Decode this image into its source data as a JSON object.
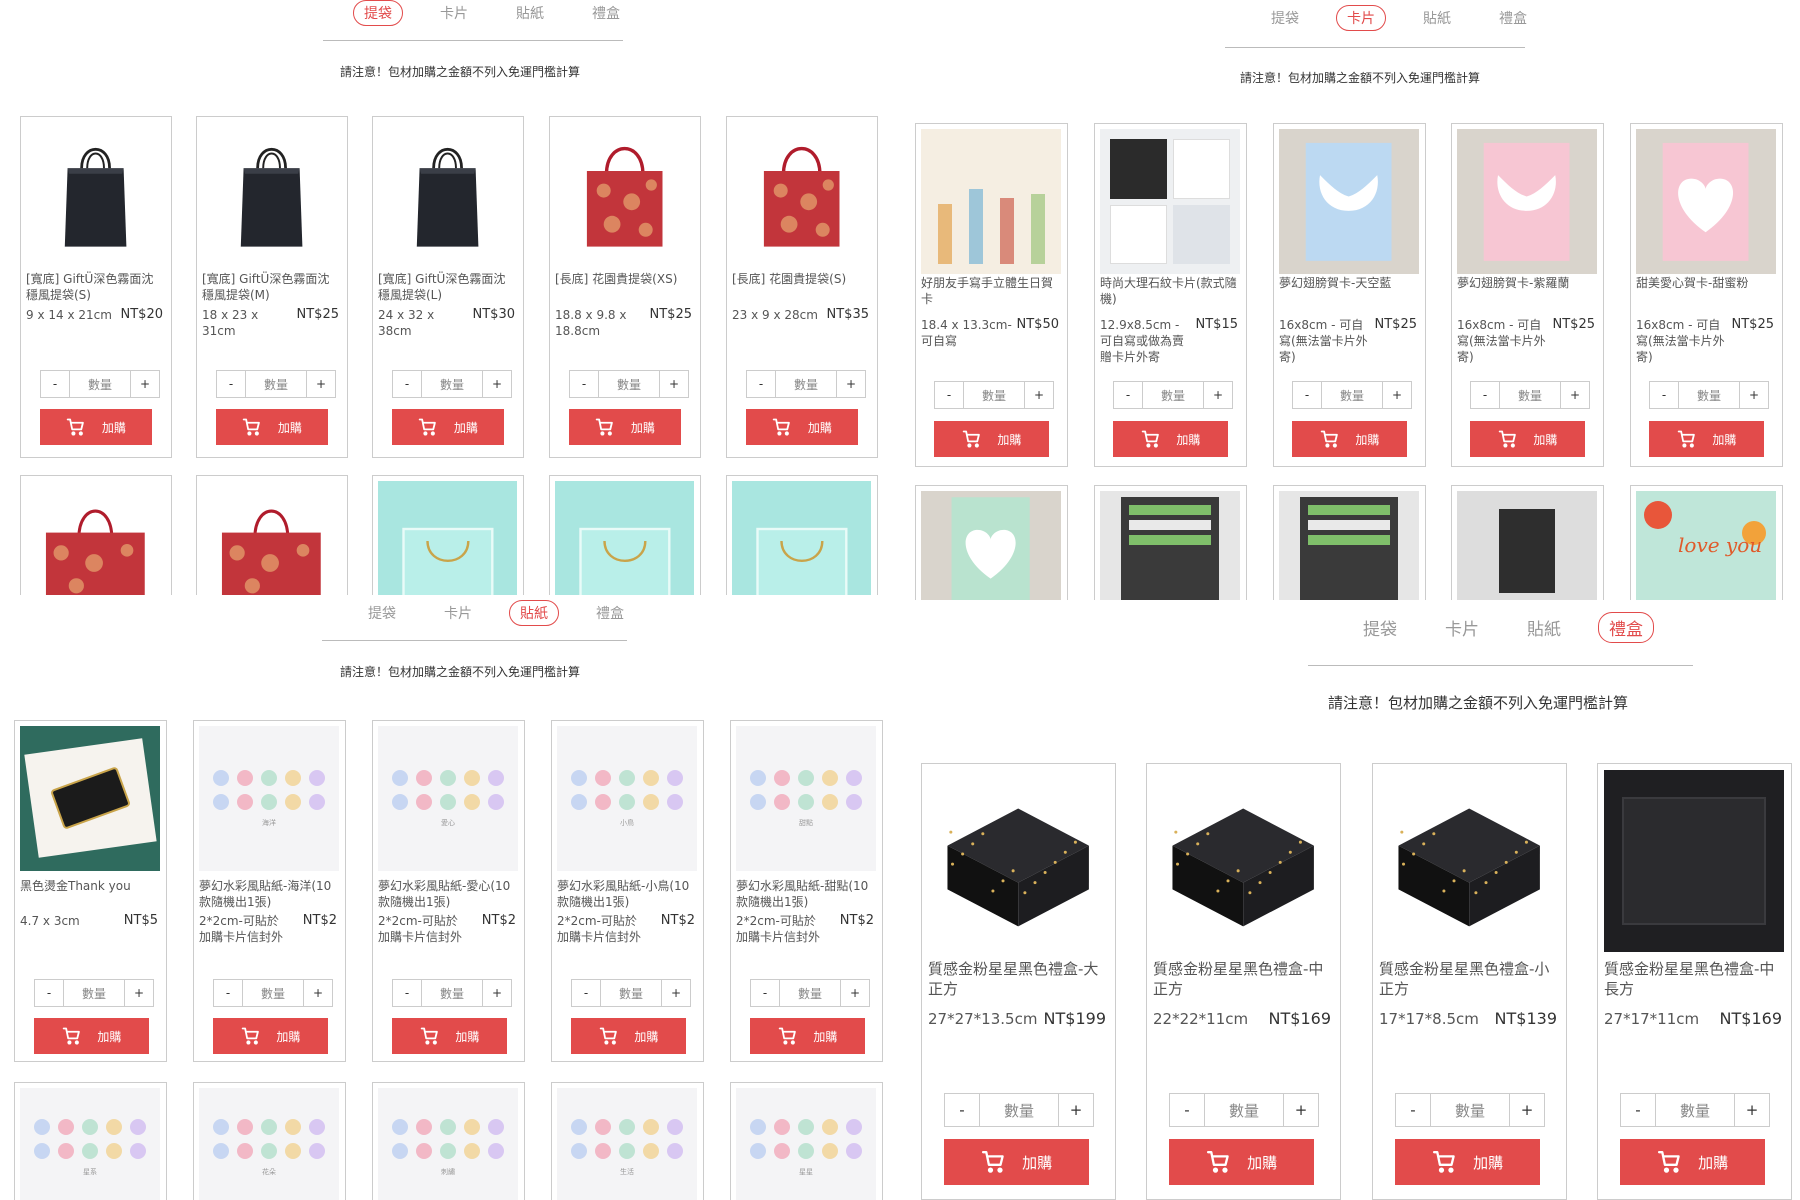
{
  "tabs": [
    "提袋",
    "卡片",
    "貼紙",
    "禮盒"
  ],
  "notice": "請注意！包材加購之金額不列入免運門檻計算",
  "stepper": {
    "minus": "-",
    "qty_placeholder": "數量",
    "plus": "+"
  },
  "buy_label": "加購",
  "bags": [
    {
      "name": "[寬底] GiftÜ深色霧面沈穩風提袋(S)",
      "size": "9 x 14 x 21cm",
      "price": "NT$20"
    },
    {
      "name": "[寬底] GiftÜ深色霧面沈穩風提袋(M)",
      "size": "18 x 23 x 31cm",
      "price": "NT$25"
    },
    {
      "name": "[寬底] GiftÜ深色霧面沈穩風提袋(L)",
      "size": "24 x 32 x 38cm",
      "price": "NT$30"
    },
    {
      "name": "[長底] 花園貴提袋(XS)",
      "size": "18.8 x 9.8 x 18.8cm",
      "price": "NT$25"
    },
    {
      "name": "[長底] 花園貴提袋(S)",
      "size": "23 x 9 x 28cm",
      "price": "NT$35"
    }
  ],
  "cards": [
    {
      "name": "好朋友手寫手立體生日賀卡",
      "size": "18.4 x 13.3cm-可自寫",
      "price": "NT$50"
    },
    {
      "name": "時尚大理石紋卡片(款式隨機)",
      "size": "12.9x8.5cm - 可自寫或做為賣贈卡片外寄",
      "price": "NT$15"
    },
    {
      "name": "夢幻翅膀賀卡-天空藍",
      "size": "16x8cm - 可自寫(無法當卡片外寄)",
      "price": "NT$25"
    },
    {
      "name": "夢幻翅膀賀卡-紫羅蘭",
      "size": "16x8cm - 可自寫(無法當卡片外寄)",
      "price": "NT$25"
    },
    {
      "name": "甜美愛心賀卡-甜蜜粉",
      "size": "16x8cm - 可自寫(無法當卡片外寄)",
      "price": "NT$25"
    }
  ],
  "stickers": [
    {
      "name": "黑色燙金Thank you",
      "size": "4.7 x 3cm",
      "price": "NT$5",
      "caption": ""
    },
    {
      "name": "夢幻水彩風貼紙-海洋(10款隨機出1張)",
      "size": "2*2cm-可貼於加購卡片信封外",
      "price": "NT$2",
      "caption": "海洋"
    },
    {
      "name": "夢幻水彩風貼紙-愛心(10款隨機出1張)",
      "size": "2*2cm-可貼於加購卡片信封外",
      "price": "NT$2",
      "caption": "愛心"
    },
    {
      "name": "夢幻水彩風貼紙-小鳥(10款隨機出1張)",
      "size": "2*2cm-可貼於加購卡片信封外",
      "price": "NT$2",
      "caption": "小鳥"
    },
    {
      "name": "夢幻水彩風貼紙-甜點(10款隨機出1張)",
      "size": "2*2cm-可貼於加購卡片信封外",
      "price": "NT$2",
      "caption": "甜點"
    }
  ],
  "sticker_row2_captions": [
    "星系",
    "花朵",
    "刺繡",
    "生活",
    "星星"
  ],
  "boxes": [
    {
      "name": "質感金粉星星黑色禮盒-大正方",
      "size": "27*27*13.5cm",
      "price": "NT$199"
    },
    {
      "name": "質感金粉星星黑色禮盒-中正方",
      "size": "22*22*11cm",
      "price": "NT$169"
    },
    {
      "name": "質感金粉星星黑色禮盒-小正方",
      "size": "17*17*8.5cm",
      "price": "NT$139"
    },
    {
      "name": "質感金粉星星黑色禮盒-中長方",
      "size": "27*17*11cm",
      "price": "NT$169"
    }
  ],
  "card_row2_text": "love you",
  "colors": {
    "accent": "#e24b4b",
    "border": "#cccccc",
    "text": "#555555"
  }
}
